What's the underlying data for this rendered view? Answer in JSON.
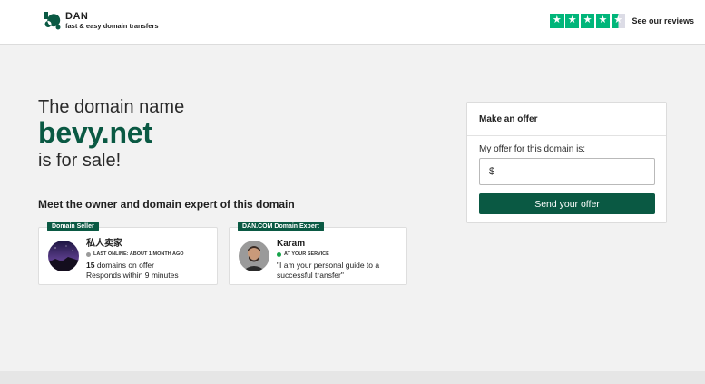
{
  "header": {
    "logo_name": "DAN",
    "logo_tagline": "fast & easy domain transfers",
    "trust_label": "See our reviews",
    "trust_rating_stars": 4.5,
    "trust_color": "#00b67a"
  },
  "hero": {
    "intro": "The domain name",
    "domain": "bevy.net",
    "suffix": "is for sale!",
    "accent_color": "#0a5943"
  },
  "meet": {
    "title": "Meet the owner and domain expert of this domain"
  },
  "seller_card": {
    "badge": "Domain Seller",
    "name": "私人卖家",
    "status": "LAST ONLINE: ABOUT 1 MONTH AGO",
    "count": "15",
    "count_suffix": " domains on offer",
    "response": "Responds within 9 minutes",
    "avatar_icon": "avatar-night-sky"
  },
  "expert_card": {
    "badge": "DAN.COM Domain Expert",
    "name": "Karam",
    "status": "AT YOUR SERVICE",
    "quote_line1": "\"I am your personal guide to a",
    "quote_line2": "successful transfer\"",
    "avatar_icon": "avatar-person"
  },
  "offer": {
    "title": "Make an offer",
    "label": "My offer for this domain is:",
    "currency": "$",
    "input_value": "",
    "button": "Send your offer"
  }
}
